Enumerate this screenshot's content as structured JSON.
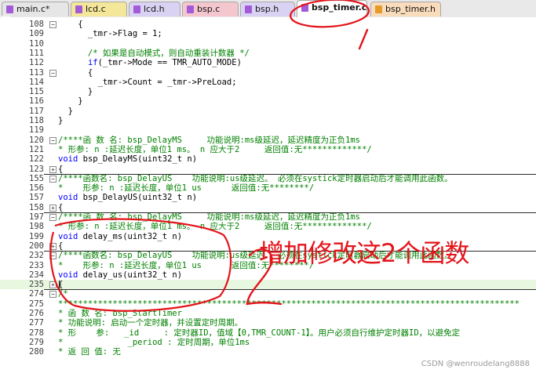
{
  "tabs": [
    {
      "label": "main.c*",
      "icon": "c-file-icon",
      "color": "#e6e6e6",
      "icon_color": "#a35ad8",
      "active": false
    },
    {
      "label": "lcd.c",
      "icon": "c-file-icon",
      "color": "#f5e79a",
      "icon_color": "#a35ad8",
      "active": false
    },
    {
      "label": "lcd.h",
      "icon": "h-file-icon",
      "color": "#d9d2f2",
      "icon_color": "#a35ad8",
      "active": false
    },
    {
      "label": "bsp.c",
      "icon": "c-file-icon",
      "color": "#f4c7cf",
      "icon_color": "#a35ad8",
      "active": false
    },
    {
      "label": "bsp.h",
      "icon": "h-file-icon",
      "color": "#d9d2f2",
      "icon_color": "#a35ad8",
      "active": false
    },
    {
      "label": "bsp_timer.c",
      "icon": "c-file-icon",
      "color": "#bfe6c6",
      "icon_color": "#a35ad8",
      "active": true
    },
    {
      "label": "bsp_timer.h",
      "icon": "h-file-icon",
      "color": "#f8dcbc",
      "icon_color": "#e59a2c",
      "active": false
    }
  ],
  "lines": [
    {
      "n": "108",
      "fold": "-",
      "text": "    {",
      "style": "code"
    },
    {
      "n": "109",
      "fold": "",
      "text": "      _tmr->Flag = 1;",
      "style": "code"
    },
    {
      "n": "110",
      "fold": "",
      "text": "",
      "style": "code"
    },
    {
      "n": "111",
      "fold": "",
      "text": "      /* 如果是自动模式，则自动重装计数器 */",
      "style": "comment"
    },
    {
      "n": "112",
      "fold": "",
      "text": "      if(_tmr->Mode == TMR_AUTO_MODE)",
      "style": "code"
    },
    {
      "n": "113",
      "fold": "-",
      "text": "      {",
      "style": "code"
    },
    {
      "n": "114",
      "fold": "",
      "text": "        _tmr->Count = _tmr->PreLoad;",
      "style": "code"
    },
    {
      "n": "115",
      "fold": "",
      "text": "      }",
      "style": "code"
    },
    {
      "n": "116",
      "fold": "",
      "text": "    }",
      "style": "code"
    },
    {
      "n": "117",
      "fold": "",
      "text": "  }",
      "style": "code"
    },
    {
      "n": "118",
      "fold": "",
      "text": "}",
      "style": "code"
    },
    {
      "n": "119",
      "fold": "",
      "text": "",
      "style": "code"
    },
    {
      "n": "120",
      "fold": "-",
      "text": "/****函 数 名: bsp_DelayMS     功能说明:ms级延迟，延迟精度为正负1ms",
      "style": "comment"
    },
    {
      "n": "121",
      "fold": "",
      "text": "* 形参: n :延迟长度，单位1 ms。 n 应大于2     返回值:无*************/",
      "style": "comment"
    },
    {
      "n": "122",
      "fold": "",
      "text": "void bsp_DelayMS(uint32_t n)",
      "style": "code"
    },
    {
      "n": "123",
      "fold": "+",
      "text": "{",
      "style": "code",
      "sep": true
    },
    {
      "n": "155",
      "fold": "-",
      "text": "/****函数名: bsp_DelayUS    功能说明:us级延迟。 必须在systick定时器启动后才能调用此函数。",
      "style": "comment"
    },
    {
      "n": "156",
      "fold": "",
      "text": "*    形参: n :延迟长度，单位1 us      返回值:无********/",
      "style": "comment"
    },
    {
      "n": "157",
      "fold": "",
      "text": "void bsp_DelayUS(uint32_t n)",
      "style": "code"
    },
    {
      "n": "158",
      "fold": "+",
      "text": "{",
      "style": "code",
      "sep": true
    },
    {
      "n": "197",
      "fold": "-",
      "text": "/****函 数 名: bsp_DelayMS     功能说明:ms级延迟，延迟精度为正负1ms",
      "style": "comment"
    },
    {
      "n": "198",
      "fold": "",
      "text": "* 形参: n :延迟长度，单位1 ms。 n 应大于2     返回值:无*************/",
      "style": "comment"
    },
    {
      "n": "199",
      "fold": "",
      "text": "void delay_ms(uint32_t n)",
      "style": "code"
    },
    {
      "n": "200",
      "fold": "+",
      "text": "{",
      "style": "code",
      "sep": true
    },
    {
      "n": "232",
      "fold": "-",
      "text": "/****函数名: bsp_DelayUS    功能说明:us级延迟。 必须在systick定时器启动后才能调用此函数。",
      "style": "comment"
    },
    {
      "n": "233",
      "fold": "",
      "text": "*    形参: n :延迟长度，单位1 us      返回值:无********/",
      "style": "comment"
    },
    {
      "n": "234",
      "fold": "",
      "text": "void delay_us(uint32_t n)",
      "style": "code"
    },
    {
      "n": "235",
      "fold": "+",
      "text": "{",
      "style": "code",
      "sep": true,
      "current": true
    },
    {
      "n": "274",
      "fold": "-",
      "text": "/*",
      "style": "comment"
    },
    {
      "n": "275",
      "fold": "",
      "text": "*********************************************************************************************",
      "style": "comment"
    },
    {
      "n": "276",
      "fold": "",
      "text": "* 函 数 名: bsp_StartTimer",
      "style": "comment"
    },
    {
      "n": "277",
      "fold": "",
      "text": "* 功能说明: 启动一个定时器，并设置定时周期。",
      "style": "comment"
    },
    {
      "n": "278",
      "fold": "",
      "text": "* 形    参:   _id     : 定时器ID，值域【0,TMR_COUNT-1】。用户必须自行维护定时器ID，以避免定",
      "style": "comment"
    },
    {
      "n": "279",
      "fold": "",
      "text": "*             _period : 定时周期，单位1ms",
      "style": "comment"
    },
    {
      "n": "280",
      "fold": "",
      "text": "* 返 回 值: 无",
      "style": "comment"
    }
  ],
  "annotation": {
    "text": "增加修改这2个函数",
    "color": "#e4141b"
  },
  "watermark": "CSDN @wenroudelang8888"
}
